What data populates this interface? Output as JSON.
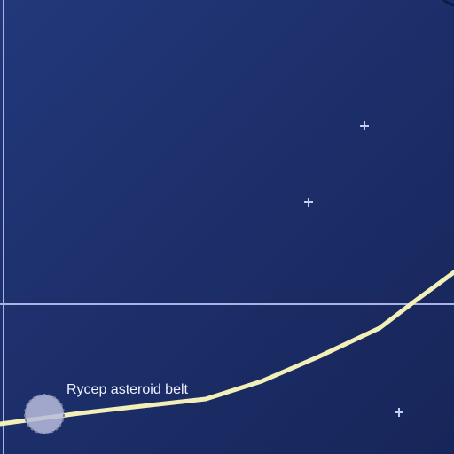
{
  "map": {
    "view": "star-map",
    "colors": {
      "background_top": "#22387a",
      "background_bottom": "#172559",
      "grid_line": "#aab2e6",
      "route": "#f3efb8",
      "marker_fill": "#b7bcdc",
      "marker_stroke": "#7a7f9f",
      "star": "#c5cdf4",
      "label": "#eef1ff"
    },
    "markers": [
      {
        "name": "Rycep asteroid belt",
        "icon": "asteroid-belt-icon"
      }
    ],
    "stars": [
      {
        "icon": "star-icon"
      },
      {
        "icon": "star-icon"
      },
      {
        "icon": "star-icon"
      }
    ]
  }
}
